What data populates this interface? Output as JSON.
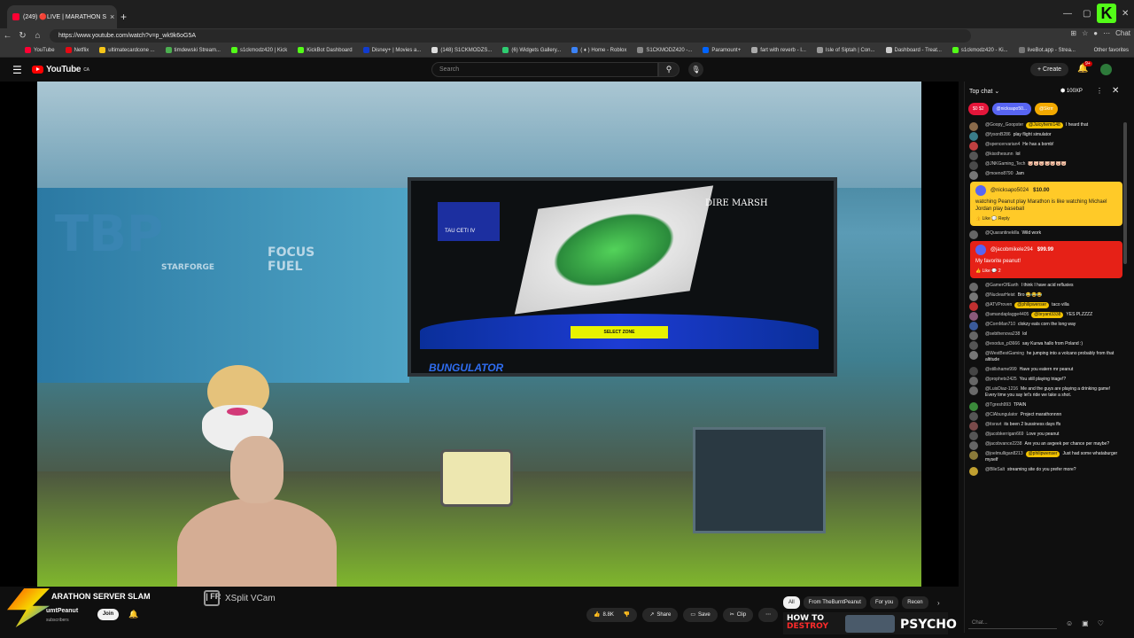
{
  "browser": {
    "tab_title": "(249) 🔴LIVE | MARATHON S",
    "url": "https://www.youtube.com/watch?v=p_wk9k6oG5A",
    "bookmarks": [
      "YouTube",
      "Netflix",
      "ultimatecardcone ...",
      "timdewski Stream...",
      "s1ckmodz420 | Kick",
      "KickBot Dashboard",
      "Disney+ | Movies a...",
      "(148) S1CKMODZS...",
      "(6) Widgets Gallery...",
      "( ♦ ) Home - Roblox",
      "S1CKMODZ420 -...",
      "Paramount+",
      "fart with reverb - I...",
      "Isle of Siptah | Con...",
      "Dashboard - Treat...",
      "s1ckmodz420 - Ki...",
      "liveBot.app - Strea..."
    ],
    "other_favorites": "Other favorites",
    "chat_label": "Chat"
  },
  "youtube": {
    "logo_text": "YouTube",
    "country": "CA",
    "search_placeholder": "Search",
    "create_label": "Create",
    "notif_count": "9+"
  },
  "video": {
    "wall_text_1": "TBP",
    "wall_text_2": "FOCUS FUEL",
    "wall_text_3": "STARFORGE",
    "monitor_title": "DIRE MARSH",
    "monitor_sub": "TAU CETI IV",
    "monitor_btn": "SELECT ZONE",
    "banner": "BUNGULATOR",
    "xsplit": "XSplit VCam"
  },
  "meta": {
    "title": "ARATHON SERVER SLAM",
    "title_tail": "| FR",
    "channel": "umtPeanut",
    "subscribers": "subscribers",
    "join": "Join",
    "likes": "8.8K",
    "share": "Share",
    "save": "Save",
    "clip": "Clip"
  },
  "chips": [
    "All",
    "From TheBurntPeanut",
    "For you",
    "Recen"
  ],
  "thumb": {
    "line1": "HOW TO",
    "line2": "DESTROY",
    "big": "PSYCHO"
  },
  "chat": {
    "title": "Top chat",
    "xp": "100XP",
    "ticker": [
      {
        "text": "$0  $2",
        "color": "#e4163a"
      },
      {
        "text": "@nicksapo50...",
        "color": "#5865f2"
      },
      {
        "text": "@Skrrr",
        "color": "#f2a900"
      }
    ],
    "messages": [
      {
        "name": "@Goopy_Goopster",
        "badge": "@Juicyhemi148",
        "text": "I heard that",
        "color": "#8a6a4a"
      },
      {
        "name": "@fysonB286",
        "badge": "",
        "text": "play flight simulator",
        "color": "#3a7d8a"
      },
      {
        "name": "@spencervarian4",
        "badge": "",
        "text": "He has a bomb!",
        "color": "#c04040"
      },
      {
        "name": "@kissthesunn",
        "badge": "",
        "text": "lol",
        "color": "#555"
      },
      {
        "name": "@JNKGaming_Tech",
        "badge": "",
        "text": "🐷🐷🐷🐷🐷🐷🐷",
        "color": "#4a4a4a"
      },
      {
        "name": "@moeno8790",
        "badge": "",
        "text": "Jam",
        "color": "#777"
      }
    ],
    "superchat1": {
      "name": "@nicksapo5024",
      "amount": "$10.00",
      "body": "watching Peanut play Marathon is like watching Michael Jordan play baseball",
      "like": "Like",
      "reply": "Reply"
    },
    "messages2": [
      {
        "name": "@Quarantinekilla",
        "badge": "",
        "text": "Wild work",
        "color": "#666"
      }
    ],
    "superchat2": {
      "name": "@jacobmikele294",
      "amount": "$99.99",
      "body": "My favorite peanut!",
      "like": "Like",
      "count": "2"
    },
    "messages3": [
      {
        "name": "@GamerOfEarth",
        "badge": "",
        "text": "I think I have acid refluxies",
        "color": "#6a6a6a"
      },
      {
        "name": "@NuclearHeist",
        "badge": "",
        "text": "Bro 😂😂😂",
        "color": "#777"
      },
      {
        "name": "@ATVProven",
        "badge": "@philipwenser",
        "text": "taco villa",
        "color": "#c03030"
      },
      {
        "name": "@amandaplagge4405",
        "badge": "@bryant3338",
        "text": "YES PLZZZZ",
        "color": "#8a5a7a"
      },
      {
        "name": "@CornMan710",
        "badge": "",
        "text": "clokzy eats corn the long way",
        "color": "#3a5a9a"
      },
      {
        "name": "@sebthenova238",
        "badge": "",
        "text": "lol",
        "color": "#666"
      },
      {
        "name": "@exodus_pl3666",
        "badge": "",
        "text": "say Kurwa hallo from Poland :)",
        "color": "#555"
      },
      {
        "name": "@WestBestGaming",
        "badge": "",
        "text": "he jumping into a volcano probably from that altitude",
        "color": "#777"
      },
      {
        "name": "@stillshame999",
        "badge": "",
        "text": "Have you eatern mr peanut",
        "color": "#444"
      },
      {
        "name": "@prophetx2425",
        "badge": "",
        "text": "You still playing triage!?",
        "color": "#666"
      },
      {
        "name": "@LuisDiaz-1216",
        "badge": "",
        "text": "Me and the guys are playing a drinking game! Every time you say let's ride we take a shot.",
        "color": "#6a6a6a"
      },
      {
        "name": "@Tgresh993",
        "badge": "",
        "text": "TPAIN",
        "color": "#3a8a3a"
      },
      {
        "name": "@ClAbungulator",
        "badge": "",
        "text": "Project marathonnnn",
        "color": "#555"
      },
      {
        "name": "@itsravt",
        "badge": "",
        "text": "its been 2 bussiness days ffs",
        "color": "#7a4a4a"
      },
      {
        "name": "@jacobkerrigan669",
        "badge": "",
        "text": "Love you peanut",
        "color": "#555"
      },
      {
        "name": "@jacobvance2238",
        "badge": "",
        "text": "Are you an avgeek per chance per maybe?",
        "color": "#666"
      },
      {
        "name": "@joelmulligan8213",
        "badge": "@philipwenser",
        "text": "Just had some whataburger myself",
        "color": "#8a7a3a"
      },
      {
        "name": "@BlleSalt",
        "badge": "",
        "text": "streaming site do you prefer more?",
        "color": "#c0a030"
      }
    ],
    "input_placeholder": "Chat..."
  }
}
